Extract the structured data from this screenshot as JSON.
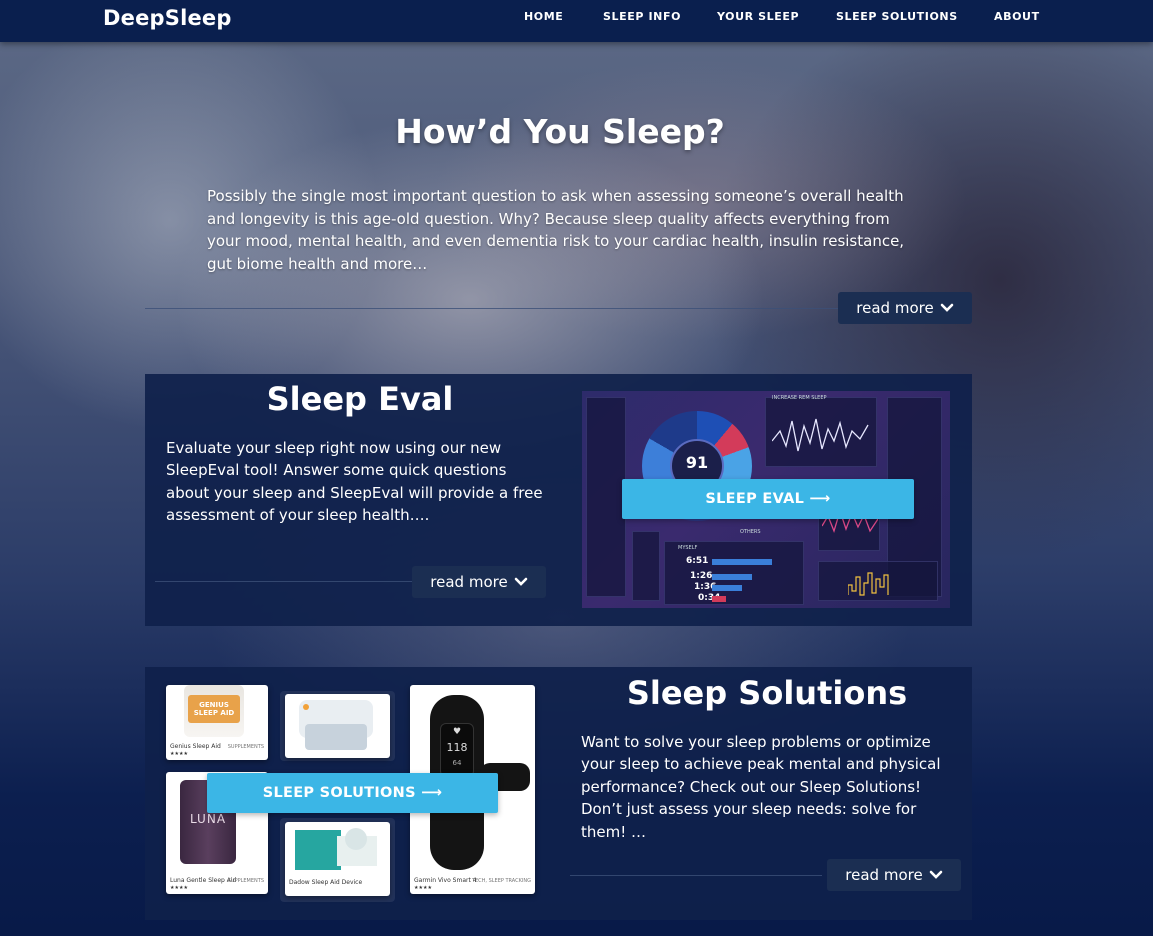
{
  "nav": {
    "brand": "DeepSleep",
    "links": [
      "HOME",
      "SLEEP INFO",
      "YOUR SLEEP",
      "SLEEP SOLUTIONS",
      "ABOUT"
    ]
  },
  "hero": {
    "title": "How’d You Sleep?",
    "text": "Possibly the single most important question to ask when assessing someone’s overall health and longevity is this age-old question. Why? Because sleep quality affects everything from your mood, mental health, and even dementia risk to your cardiac health, insulin resistance, gut biome health and more…",
    "read_more": "read more"
  },
  "eval": {
    "title": "Sleep Eval",
    "text": "Evaluate your sleep right now using our new SleepEval tool! Answer some quick questions about your sleep and SleepEval will provide a free assessment of your sleep health….",
    "read_more": "read more",
    "cta": "SLEEP EVAL ⟶",
    "dashboard": {
      "score": "91",
      "times": [
        "6:51",
        "1:26",
        "1:36",
        "0:34"
      ],
      "labels": [
        "MYSELF",
        "OTHERS",
        "INCREASE REM SLEEP"
      ]
    }
  },
  "solutions": {
    "title": "Sleep Solutions",
    "text": "Want to solve your sleep problems or optimize your sleep to achieve peak mental and physical performance? Check out our Sleep Solutions! Don’t just assess your sleep needs: solve for them! …",
    "read_more": "read more",
    "cta": "SLEEP SOLUTIONS ⟶",
    "products": [
      {
        "name": "Genius Sleep Aid",
        "tag": "SUPPLEMENTS",
        "brand_text": "GENIUS SLEEP AID"
      },
      {
        "name": "Luna Gentle Sleep Aid",
        "tag": "SUPPLEMENTS",
        "brand_text": "LUNA"
      },
      {
        "name": "Dadow Sleep Aid Device",
        "tag": ""
      },
      {
        "name": "Garmin Vivo Smart 4",
        "tag": "TECH, SLEEP TRACKING",
        "watch_text": "118",
        "watch_sub": "64"
      }
    ]
  },
  "colors": {
    "nav_bg": "#0a1f4e",
    "accent": "#3bb6e6",
    "panel_bg": "#0f214b",
    "button_bg": "#1b2e52"
  }
}
